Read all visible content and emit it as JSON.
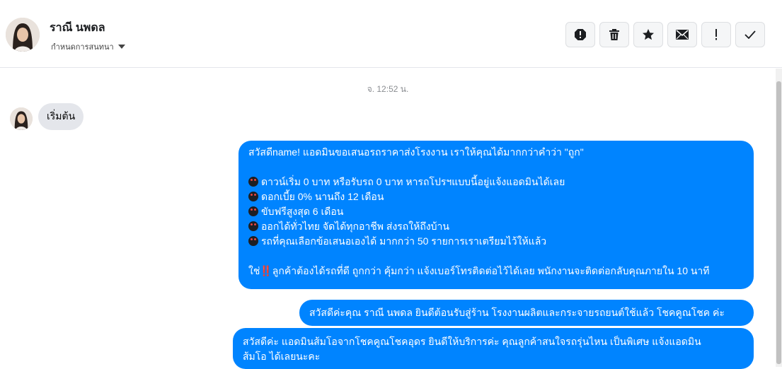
{
  "header": {
    "contact_name": "ราณี นพดล",
    "label_selector": "กำหนดการสนทนา",
    "actions": [
      "report-icon",
      "trash-icon",
      "star-icon",
      "mail-icon",
      "exclamation-icon",
      "check-icon"
    ]
  },
  "thread": {
    "timestamp": "จ. 12:52 น.",
    "incoming": "เริ่มต้น",
    "outgoing1": {
      "intro": "สวัสดีname! แอดมินขอเสนอรถราคาส่งโรงงาน เราให้คุณได้มากกว่าคำว่า \"ถูก\"",
      "bullets": [
        "ดาวน์เริ่ม 0 บาท หรือรับรถ 0 บาท หารถโปรฯแบบนี้อยู่แจ้งแอดมินได้เลย",
        "ดอกเบี้ย 0% นานถึง 12 เดือน",
        "ขับฟรีสูงสุด 6 เดือน",
        "ออกได้ทั่วไทย จัดได้ทุกอาชีพ ส่งรถให้ถึงบ้าน",
        "รถที่คุณเลือกข้อเสนอเองได้ มากกว่า 50 รายการเราเตรียมไว้ให้แล้ว"
      ],
      "closing_prefix": "ใช่",
      "closing_mark": "‼️",
      "closing_rest": "ลูกค้าต้องได้รถที่ดี ถูกกว่า คุ้มกว่า แจ้งเบอร์โทรติดต่อไว้ได้เลย พนักงานจะติดต่อกลับคุณภายใน 10 นาที"
    },
    "outgoing2": "สวัสดีค่ะคุณ ราณี นพดล ยินดีต้อนรับสู่ร้าน โรงงานผลิตและกระจายรถยนต์ใช้แล้ว โชคคูณโชค ค่ะ",
    "outgoing3_line1": "สวัสดีค่ะ แอดมินส้มโอจากโชคคูณโชคอุดร ยินดีให้บริการค่ะ   คุณลูกค้าสนใจรถรุ่นไหน เป็นพิเศษ แจ้งแอดมิน",
    "outgoing3_line2": "ส้มโอ ได้เลยนะคะ"
  },
  "colors": {
    "bubble_out": "#0084ff",
    "bubble_in": "#e4e6eb"
  }
}
